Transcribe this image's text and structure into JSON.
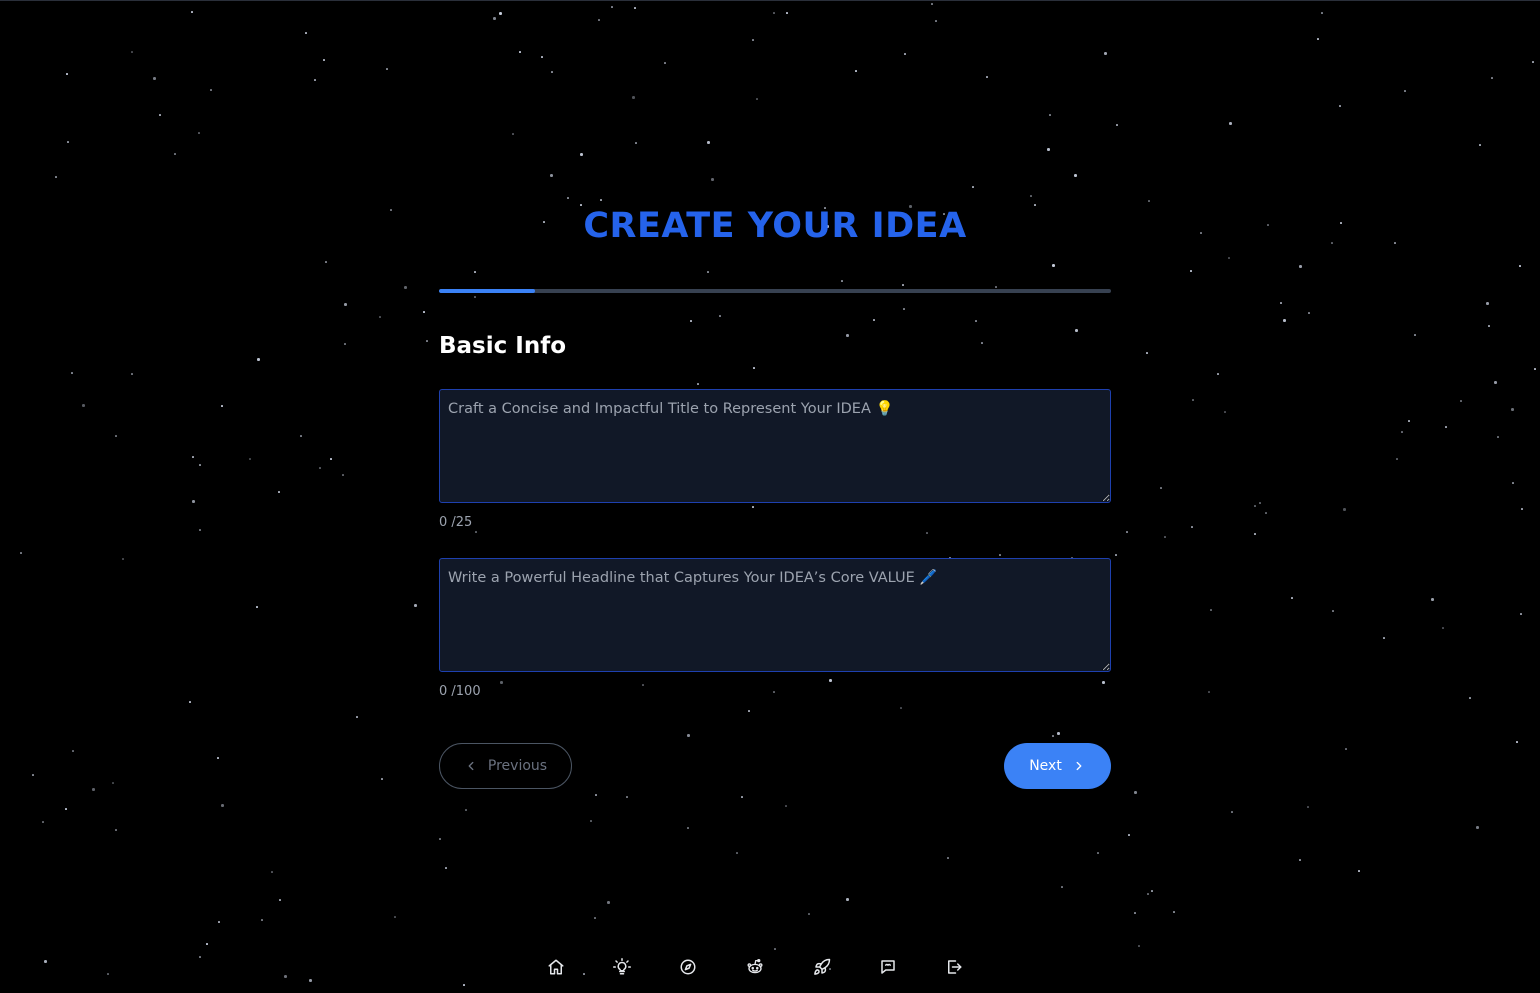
{
  "header": {
    "title": "CREATE YOUR IDEA"
  },
  "progress": {
    "fraction": 0.143,
    "track_color": "#374151",
    "fill_color": "#3b82f6"
  },
  "section": {
    "title": "Basic Info"
  },
  "fields": {
    "title": {
      "value": "",
      "placeholder": "Craft a Concise and Impactful Title to Represent Your IDEA 💡",
      "counter": "0 /25"
    },
    "headline": {
      "value": "",
      "placeholder": "Write a Powerful Headline that Captures Your IDEA’s Core VALUE 🖊️",
      "counter": "0 /100"
    }
  },
  "buttons": {
    "previous": "Previous",
    "next": "Next"
  },
  "bottom_nav": {
    "items": [
      {
        "icon": "home-icon"
      },
      {
        "icon": "lightbulb-icon"
      },
      {
        "icon": "compass-icon"
      },
      {
        "icon": "reddit-icon"
      },
      {
        "icon": "rocket-icon"
      },
      {
        "icon": "chat-icon"
      },
      {
        "icon": "logout-icon"
      }
    ]
  },
  "colors": {
    "accent": "#2563eb",
    "button": "#3b82f6",
    "background": "#000000",
    "input_bg": "#111827"
  }
}
